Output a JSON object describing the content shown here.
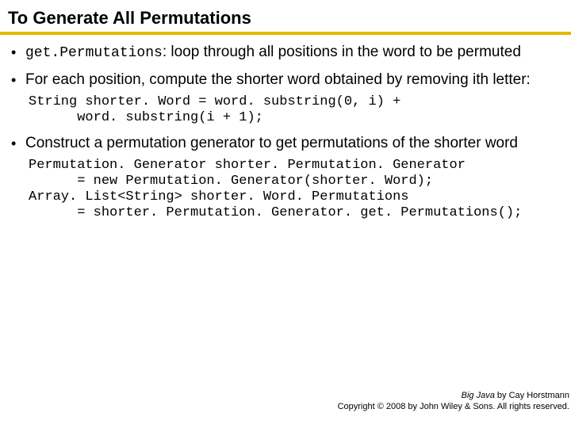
{
  "title": "To Generate All Permutations",
  "bullets": {
    "b1": {
      "code": "get.Permutations",
      "rest": ": loop through all positions in the word to be permuted"
    },
    "b2": "For each position, compute the shorter word obtained by removing ith letter:",
    "b3": "Construct a permutation generator to get permutations of the shorter word"
  },
  "code1": "String shorter. Word = word. substring(0, i) +\n      word. substring(i + 1);",
  "code2": "Permutation. Generator shorter. Permutation. Generator\n      = new Permutation. Generator(shorter. Word);\nArray. List<String> shorter. Word. Permutations\n      = shorter. Permutation. Generator. get. Permutations();",
  "footer": {
    "book": "Big Java",
    "author": " by Cay Horstmann",
    "copyright": "Copyright © 2008 by John Wiley & Sons.  All rights reserved."
  }
}
